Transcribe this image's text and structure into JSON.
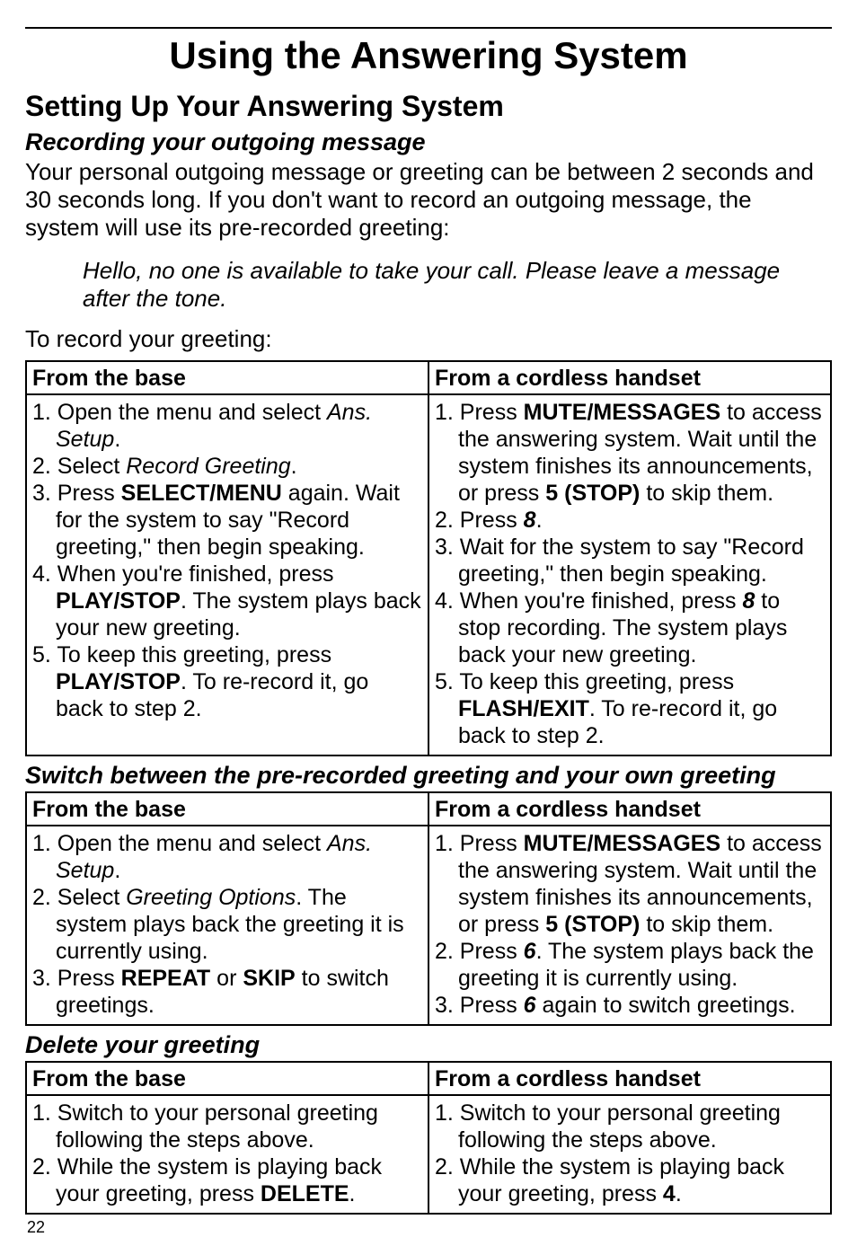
{
  "pageNumber": "22",
  "title": "Using the Answering System",
  "section": "Setting Up Your Answering System",
  "recording": {
    "heading": "Recording your outgoing message",
    "intro": "Your personal outgoing message or greeting can be between 2 seconds and 30 seconds long. If you don't want to record an outgoing message, the system will use its pre-recorded greeting:",
    "quote": "Hello, no one is available to take your call. Please leave a message after the tone.",
    "lead": "To record your greeting:",
    "header_base": "From the base",
    "header_handset": "From a cordless handset",
    "base": {
      "s1a": "1. Open the menu and select ",
      "s1b": "Ans. Setup",
      "s1c": ".",
      "s2a": "2. Select ",
      "s2b": "Record Greeting",
      "s2c": ".",
      "s3a": "3. Press ",
      "s3b": "SELECT/MENU",
      "s3c": " again. Wait for the system to say \"Record greeting,\" then begin speaking.",
      "s4a": "4. When you're finished, press ",
      "s4b": "PLAY/STOP",
      "s4c": ". The system plays back your new greeting.",
      "s5a": "5. To keep this greeting, press ",
      "s5b": "PLAY/STOP",
      "s5c": ". To re-record it, go back to step 2."
    },
    "handset": {
      "s1a": "1. Press ",
      "s1b": "MUTE/MESSAGES",
      "s1c": " to access the answering system. Wait until the system finishes its announcements, or press ",
      "s1d": "5 (STOP)",
      "s1e": " to skip them.",
      "s2a": "2. Press ",
      "s2b": "8",
      "s2c": ".",
      "s3": "3. Wait for the system to say \"Record greeting,\" then begin speaking.",
      "s4a": "4. When you're finished, press ",
      "s4b": "8",
      "s4c": " to stop recording. The system plays back your new greeting.",
      "s5a": "5. To keep this greeting, press ",
      "s5b": "FLASH/EXIT",
      "s5c_pre": ".",
      "s5c": "  To re-record it, go back to step 2."
    }
  },
  "switch": {
    "heading": "Switch between the pre-recorded greeting and your own greeting",
    "header_base": "From the base",
    "header_handset": "From a cordless handset",
    "base": {
      "s1a": "1. Open the menu and select ",
      "s1b": "Ans. Setup",
      "s1c": ".",
      "s2a": "2. Select ",
      "s2b": "Greeting Options",
      "s2c": ". The system plays back the greeting it is currently using.",
      "s3a": "3. Press ",
      "s3b": "REPEAT",
      "s3c": " or ",
      "s3d": "SKIP",
      "s3e": " to switch greetings."
    },
    "handset": {
      "s1a": "1. Press ",
      "s1b": "MUTE/MESSAGES",
      "s1c": " to access the answering system. Wait until the system finishes its announcements, or press ",
      "s1d": "5 (STOP)",
      "s1e": " to skip them.",
      "s2a": "2. Press ",
      "s2b": "6",
      "s2c": ". The system plays back the greeting it is currently using.",
      "s3a": "3. Press ",
      "s3b": "6",
      "s3c": " again to switch greetings."
    }
  },
  "delete": {
    "heading": "Delete your greeting",
    "header_base": "From the base",
    "header_handset": "From a cordless handset",
    "base": {
      "s1": "1. Switch to your personal greeting following the steps above.",
      "s2a": "2. While the system is playing back your greeting, press ",
      "s2b": "DELETE",
      "s2c": "."
    },
    "handset": {
      "s1": "1. Switch to your personal greeting following the steps above.",
      "s2a": "2. While the system is playing back your greeting, press ",
      "s2b": "4",
      "s2c": "."
    }
  }
}
